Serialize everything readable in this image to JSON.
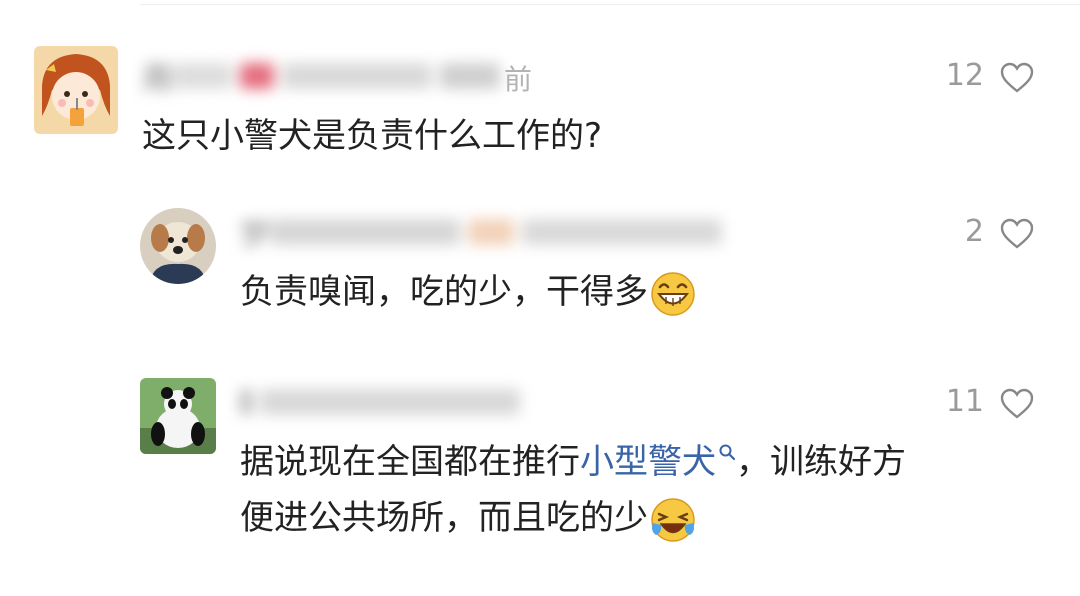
{
  "comments": [
    {
      "username": "周",
      "meta_suffix": "前",
      "text": "这只小警犬是负责什么工作的?",
      "likes": "12"
    },
    {
      "username": "梦",
      "text": "负责嗅闻，吃的少，干得多",
      "emoji": "grinning-face",
      "likes": "2"
    },
    {
      "username": "",
      "text_line1_before": "据说现在全国都在推行",
      "text_link": "小型警犬",
      "text_line1_after": "，训练好方",
      "text_line2": "便进公共场所，而且吃的少",
      "emoji": "laughing-tears-face",
      "likes": "11"
    }
  ],
  "icons": {
    "like": "heart-outline-icon",
    "search": "search-icon"
  },
  "colors": {
    "link": "#3a64a8",
    "text": "#222222",
    "muted": "#9a9a9a"
  }
}
